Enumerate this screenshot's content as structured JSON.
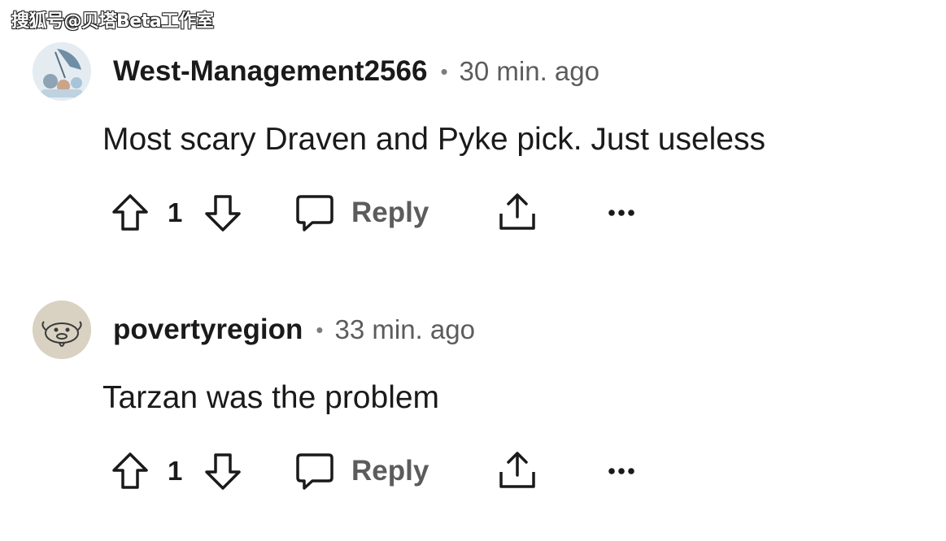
{
  "watermark": "搜狐号@贝塔Beta工作室",
  "comments": [
    {
      "username": "West-Management2566",
      "separator": "•",
      "time": "30 min. ago",
      "body": "Most scary Draven and Pyke pick. Just useless",
      "score": "1",
      "reply_label": "Reply"
    },
    {
      "username": "povertyregion",
      "separator": "•",
      "time": "33 min. ago",
      "body": "Tarzan was the problem",
      "score": "1",
      "reply_label": "Reply"
    }
  ],
  "icons": {
    "upvote": "arrow-up-outline-icon",
    "downvote": "arrow-down-outline-icon",
    "reply": "speech-bubble-icon",
    "share": "share-upload-icon",
    "more": "more-dots-icon"
  },
  "colors": {
    "text": "#1a1a1b",
    "meta": "#5c5c5c",
    "background": "#ffffff"
  }
}
